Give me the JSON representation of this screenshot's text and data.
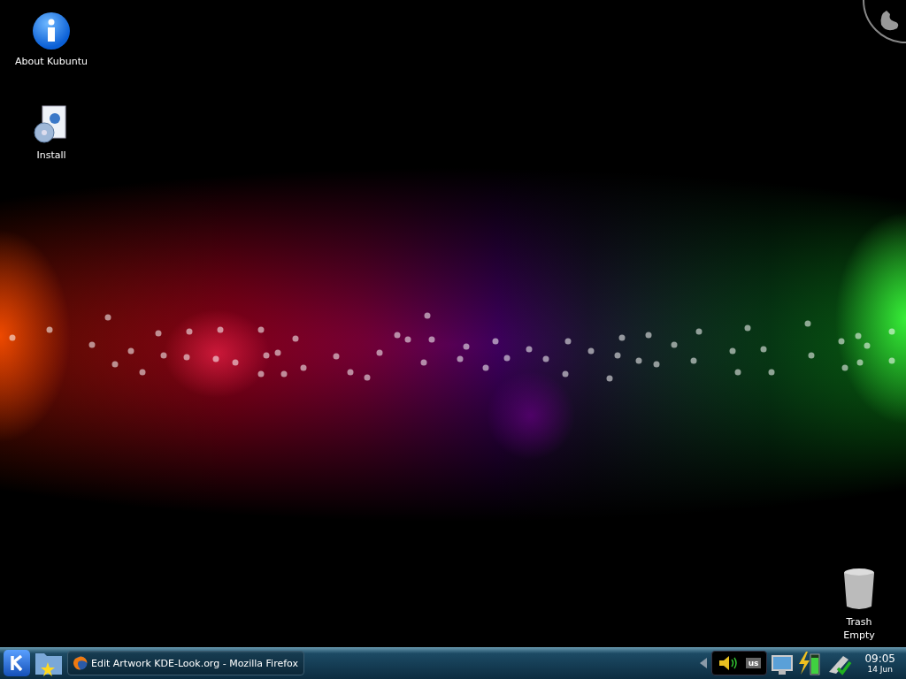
{
  "desktop_icons": [
    {
      "label": "About Kubuntu",
      "kind": "info"
    },
    {
      "label": "Install",
      "kind": "installer"
    }
  ],
  "trash": {
    "label": "Trash",
    "status": "Empty"
  },
  "taskbar": {
    "tasks": [
      {
        "title": "Edit Artwork KDE-Look.org - Mozilla Firefox",
        "selected": false
      }
    ],
    "keyboard_layout": "us",
    "clock": {
      "time": "09:05",
      "date": "14 Jun"
    }
  }
}
